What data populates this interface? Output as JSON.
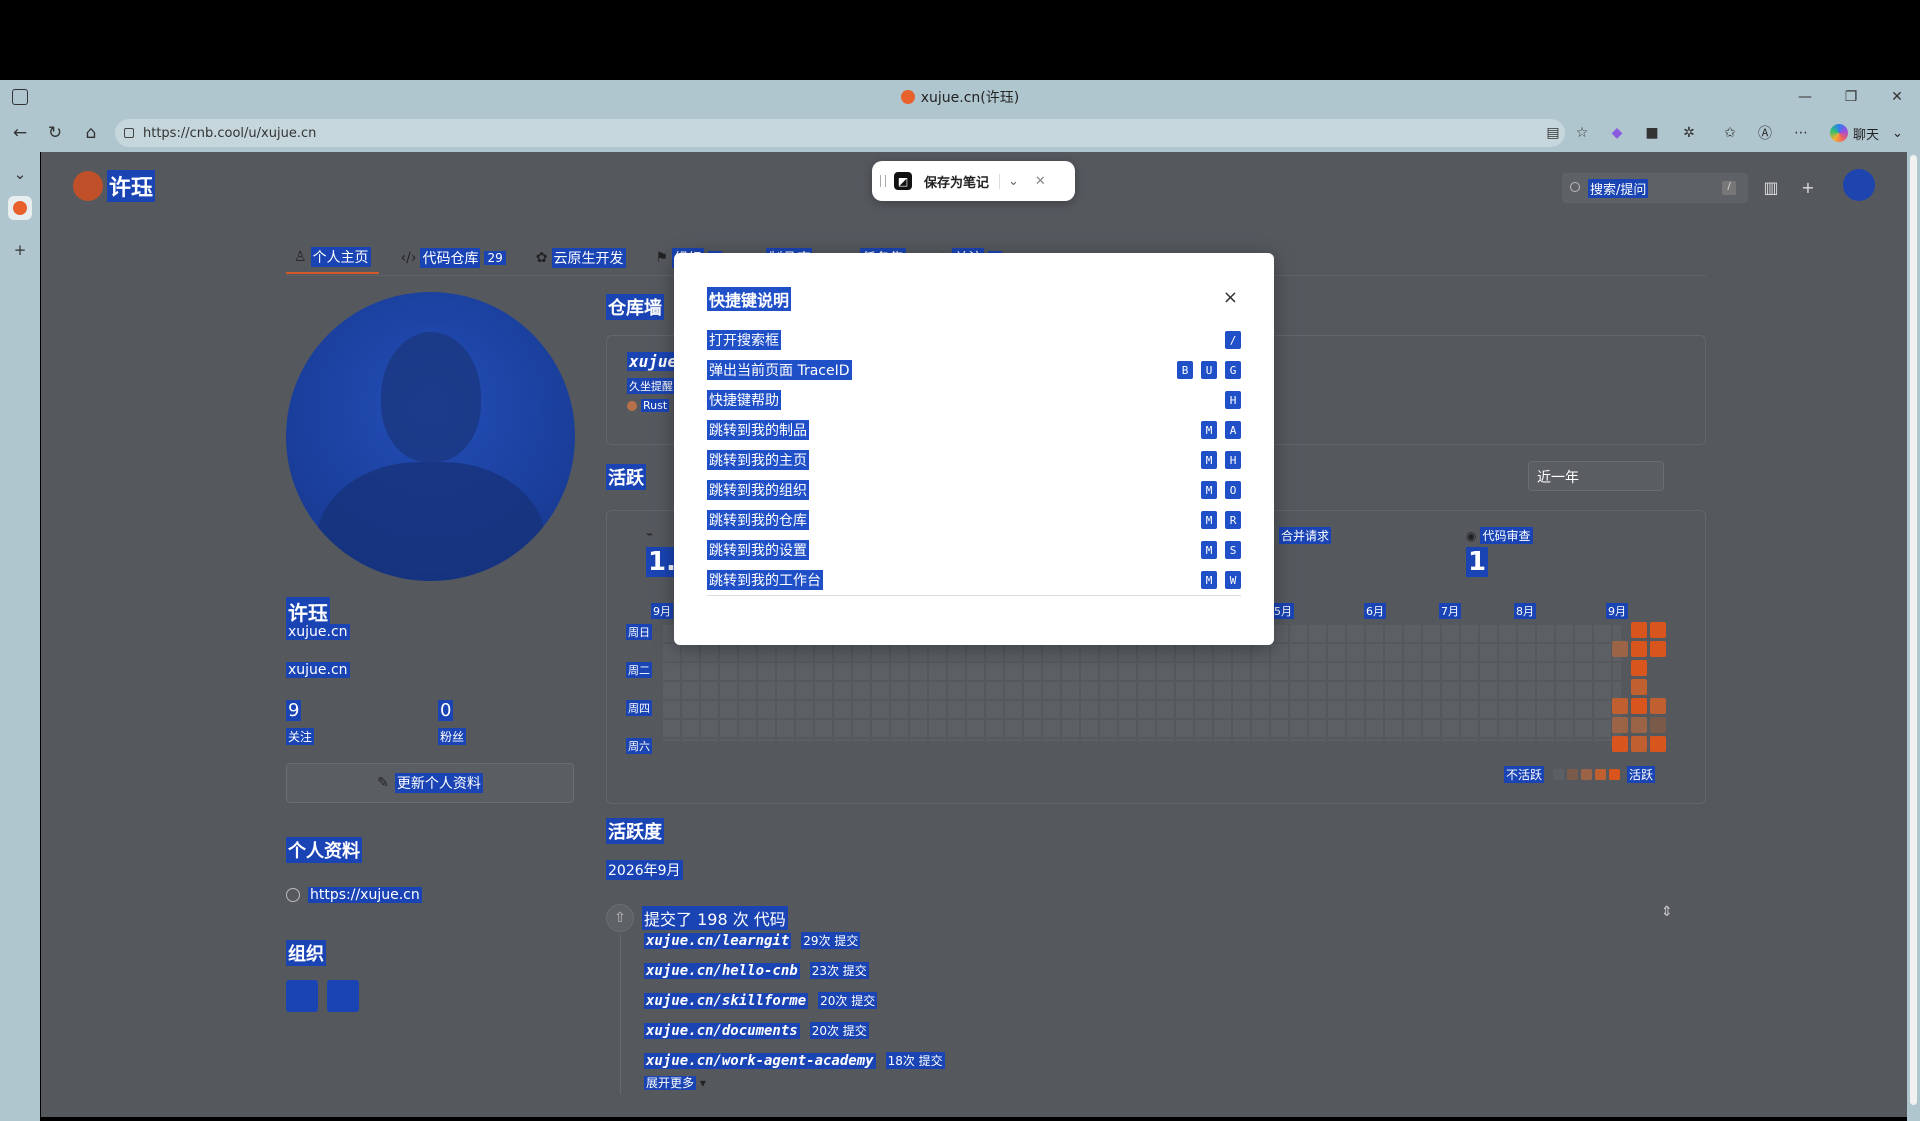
{
  "browser": {
    "tab_title": "xujue.cn(许珏)",
    "url": "https://cnb.cool/u/xujue.cn",
    "chat_label": "聊天"
  },
  "note_toolbar": {
    "save_label": "保存为笔记"
  },
  "header": {
    "brand": "许珏",
    "search_placeholder": "搜索/提问",
    "search_key": "/"
  },
  "profile_tabs": [
    {
      "label": "个人主页",
      "count": ""
    },
    {
      "label": "代码仓库",
      "count": "29"
    },
    {
      "label": "云原生开发",
      "count": ""
    },
    {
      "label": "组织",
      "count": "2"
    },
    {
      "label": "制品库",
      "count": ""
    },
    {
      "label": "任务集",
      "count": ""
    },
    {
      "label": "关注",
      "count": "9"
    }
  ],
  "user": {
    "name": "许珏",
    "id": "xujue.cn",
    "bio": "xujue.cn",
    "following": "9",
    "following_label": "关注",
    "followers": "0",
    "followers_label": "粉丝",
    "edit_label": "更新个人资料",
    "profile_title": "个人资料",
    "website": "https://xujue.cn",
    "org_title": "组织"
  },
  "repo_wall": {
    "title": "仓库墙",
    "repo_name": "xujue",
    "desc": "久坐提醒",
    "lang": "Rust"
  },
  "activity": {
    "title": "活跃",
    "range": "近一年",
    "metrics": [
      {
        "label": "",
        "value": "1."
      },
      {
        "label": "合并请求",
        "value": ""
      },
      {
        "label": "代码审查",
        "value": "1"
      }
    ],
    "months": [
      "9月",
      "5月",
      "6月",
      "7月",
      "8月",
      "9月"
    ],
    "days": [
      "周日",
      "周二",
      "周四",
      "周六"
    ],
    "legend_less": "不活跃",
    "legend_more": "活跃",
    "colors": {
      "l1": "#7a5a48",
      "l2": "#9c6446",
      "l3": "#c06030",
      "l4": "#d9551e"
    }
  },
  "activeness": {
    "title": "活跃度",
    "month": "2026年9月",
    "summary": "提交了 198 次 代码",
    "repos": [
      {
        "name": "xujue.cn/learngit",
        "count": "29次 提交"
      },
      {
        "name": "xujue.cn/hello-cnb",
        "count": "23次 提交"
      },
      {
        "name": "xujue.cn/skillforme",
        "count": "20次 提交"
      },
      {
        "name": "xujue.cn/documents",
        "count": "20次 提交"
      },
      {
        "name": "xujue.cn/work-agent-academy",
        "count": "18次 提交"
      }
    ],
    "more_label": "展开更多"
  },
  "shortcuts_modal": {
    "title": "快捷键说明",
    "items": [
      {
        "label": "打开搜索框",
        "keys": [
          "/"
        ]
      },
      {
        "label": "弹出当前页面 TraceID",
        "keys": [
          "B",
          "U",
          "G"
        ]
      },
      {
        "label": "快捷键帮助",
        "keys": [
          "H"
        ]
      },
      {
        "label": "跳转到我的制品",
        "keys": [
          "M",
          "A"
        ]
      },
      {
        "label": "跳转到我的主页",
        "keys": [
          "M",
          "H"
        ]
      },
      {
        "label": "跳转到我的组织",
        "keys": [
          "M",
          "O"
        ]
      },
      {
        "label": "跳转到我的仓库",
        "keys": [
          "M",
          "R"
        ]
      },
      {
        "label": "跳转到我的设置",
        "keys": [
          "M",
          "S"
        ]
      },
      {
        "label": "跳转到我的工作台",
        "keys": [
          "M",
          "W"
        ]
      }
    ]
  }
}
